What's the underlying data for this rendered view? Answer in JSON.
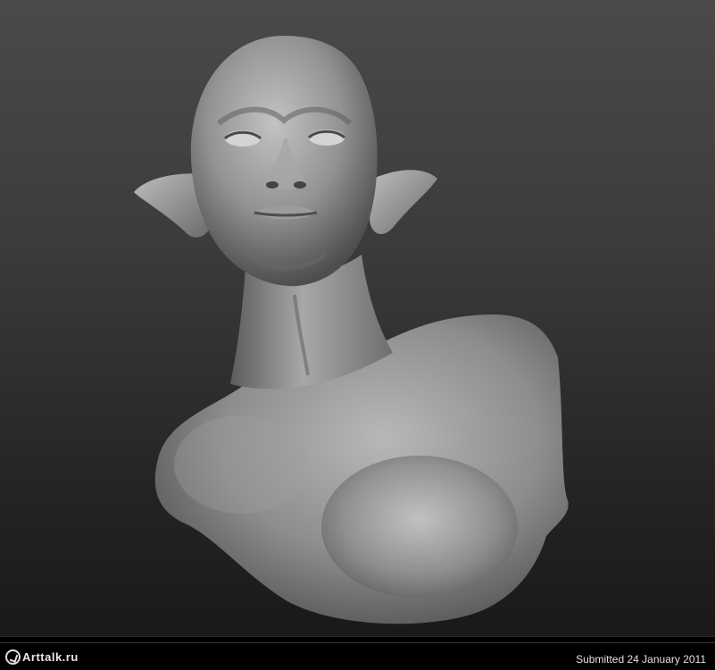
{
  "watermark": {
    "logo_text": "Arttalk.ru",
    "logo_icon": "arttalk-logo-icon"
  },
  "footer": {
    "submitted": "Submitted 24 January 2011"
  },
  "colors": {
    "background_top": "#4a4a4a",
    "background_bottom": "#161616",
    "sculpt_clay": "#9a9a9a",
    "footer_bg": "#000000"
  }
}
